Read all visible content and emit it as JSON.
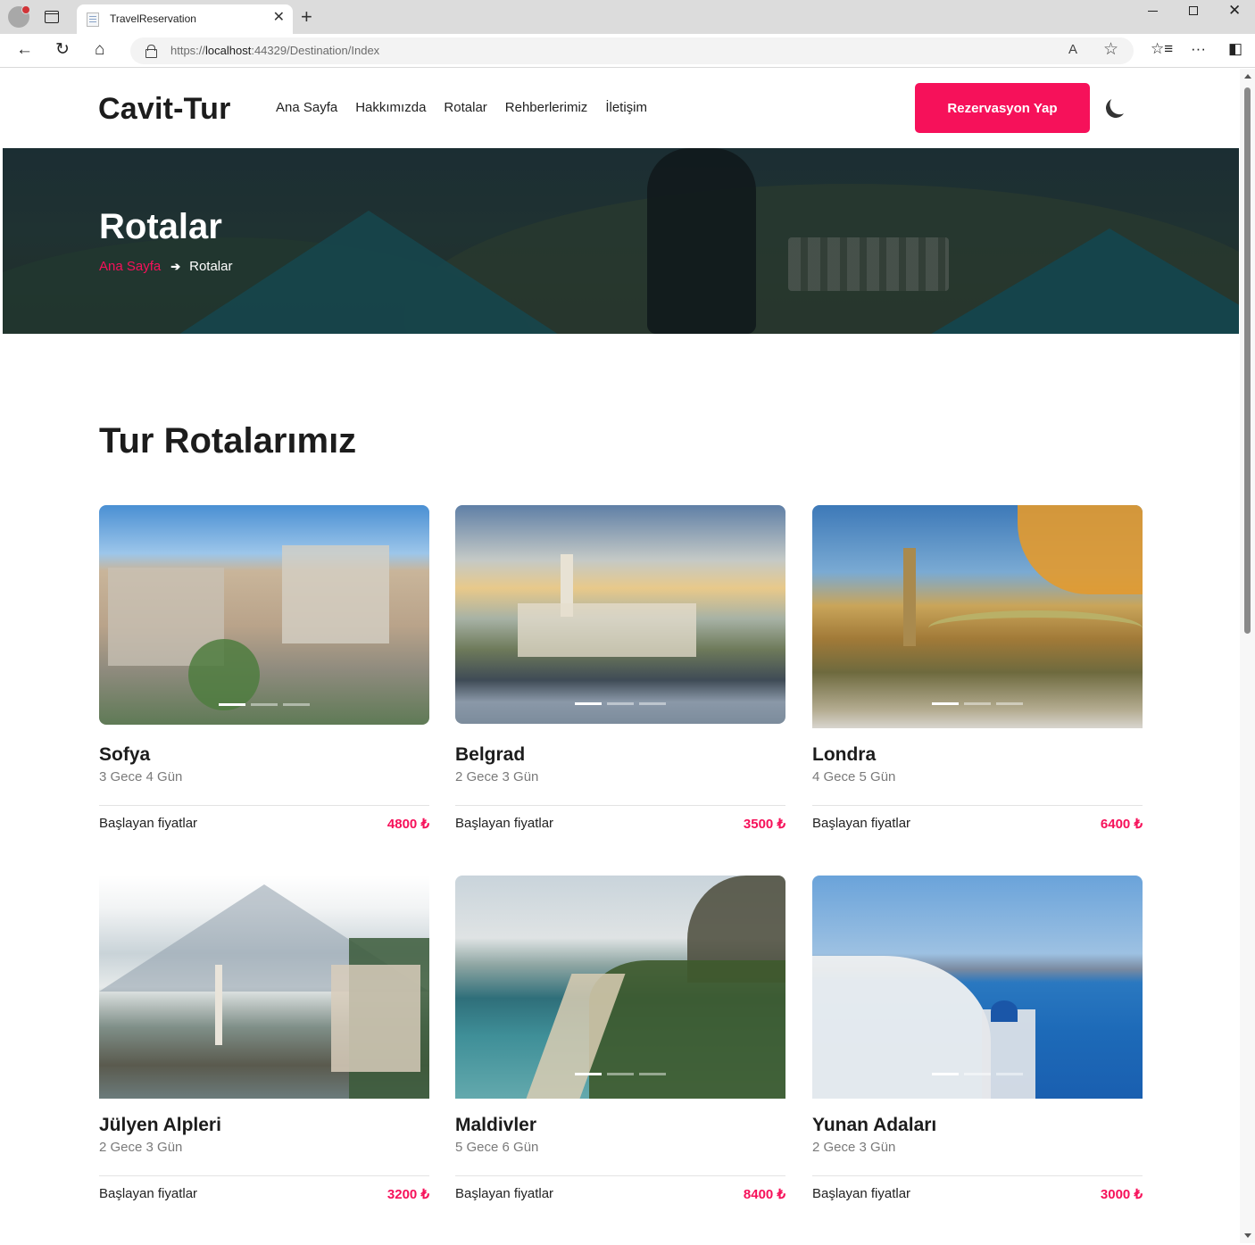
{
  "browser": {
    "tab_title": "TravelReservation",
    "tab_close": "✕",
    "new_tab": "+",
    "url_prefix": "https://",
    "url_host": "localhost",
    "url_rest": ":44329/Destination/Index",
    "win_close": "✕",
    "icons": {
      "back": "←",
      "refresh": "↻",
      "home": "⌂",
      "read_aloud": "A",
      "favorite": "☆",
      "favorites_bar": "☆≡",
      "more": "···",
      "split": "◧"
    }
  },
  "site": {
    "logo": "Cavit-Tur",
    "menu": [
      "Ana Sayfa",
      "Hakkımızda",
      "Rotalar",
      "Rehberlerimiz",
      "İletişim"
    ],
    "cta": "Rezervasyon Yap",
    "accent": "#f6115a"
  },
  "hero": {
    "title": "Rotalar",
    "breadcrumb_home": "Ana Sayfa",
    "breadcrumb_arrow": "➔",
    "breadcrumb_current": "Rotalar"
  },
  "section_title": "Tur Rotalarımız",
  "price_label": "Başlayan fiyatlar",
  "tours": [
    {
      "name": "Sofya",
      "duration": "3 Gece 4 Gün",
      "price": "4800 ₺"
    },
    {
      "name": "Belgrad",
      "duration": "2 Gece 3 Gün",
      "price": "3500 ₺"
    },
    {
      "name": "Londra",
      "duration": "4 Gece 5 Gün",
      "price": "6400 ₺"
    },
    {
      "name": "Jülyen Alpleri",
      "duration": "2 Gece 3 Gün",
      "price": "3200 ₺"
    },
    {
      "name": "Maldivler",
      "duration": "5 Gece 6 Gün",
      "price": "8400 ₺"
    },
    {
      "name": "Yunan Adaları",
      "duration": "2 Gece 3 Gün",
      "price": "3000 ₺"
    }
  ]
}
